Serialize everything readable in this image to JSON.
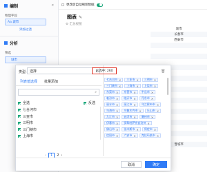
{
  "left_panel": {
    "title": "编制",
    "field_label": "物理字段",
    "field_chip": "Aa 城市",
    "tooltip": "添加过滤",
    "analysis_title": "分析",
    "filter_label": "筛选",
    "filter_chip": "城市"
  },
  "header": {
    "toggle_label": "更改后自动刷新数据",
    "chart_title": "图表",
    "subtitle": "汇总视图"
  },
  "table_rows": [
    "城市",
    "长春市",
    "西安市",
    "",
    "",
    "",
    "",
    "",
    "",
    "",
    "",
    "",
    "",
    "",
    "",
    "",
    "",
    "",
    "",
    "",
    "",
    "晋城市"
  ],
  "dialog": {
    "type_label": "类型:",
    "type_value": "选择",
    "tabs": [
      "列表值选择",
      "批量添加"
    ],
    "search_placeholder": "",
    "select_all": "全选",
    "invert": "反选",
    "list_items": [
      "七台河市",
      "三亚市",
      "三明市",
      "三门峡市",
      "上海市"
    ],
    "pagination": {
      "pages": [
        "1",
        "2"
      ]
    },
    "selected_label": "已选中: 260",
    "selected_tags": [
      [
        "七台河市",
        "三亚市",
        "三明市"
      ],
      [
        "三门峡市",
        "上海市",
        "上饶市"
      ],
      [
        "东莞市",
        "东营市",
        "中山市"
      ],
      [
        "临汾市",
        "临沂市",
        "丹东市"
      ],
      [
        "丽水市",
        "丽江市",
        "乌兰察布市"
      ],
      [
        "乌海市",
        "乌鲁木齐市",
        "乐山市"
      ],
      [
        "九江市",
        "云浮市",
        "亳州市"
      ],
      [
        "伊春市",
        "伊犁哈萨克自治州"
      ],
      [
        "佛山市",
        "佳木斯市",
        "保定市"
      ],
      [
        "信阳市",
        "六安市",
        "克拉玛依市"
      ]
    ],
    "cancel": "取消",
    "confirm": "确定"
  }
}
